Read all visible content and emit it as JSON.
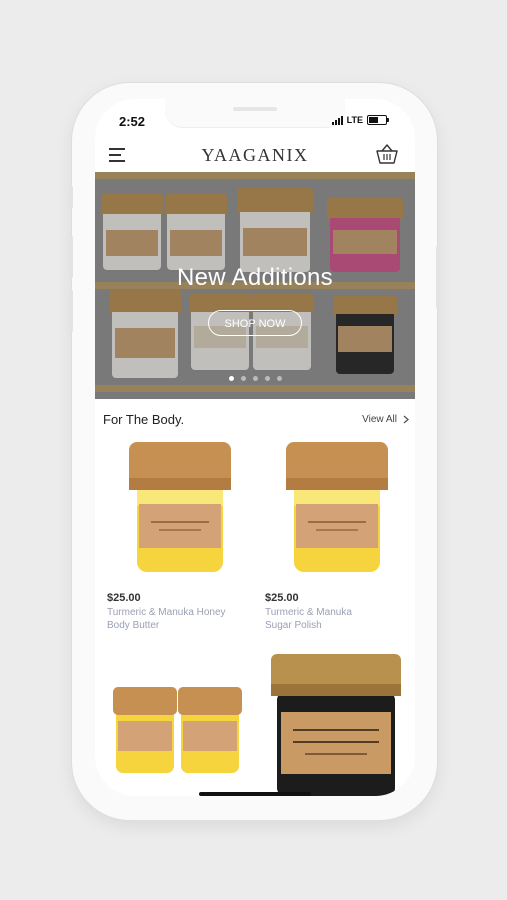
{
  "status_bar": {
    "time": "2:52",
    "network": "LTE"
  },
  "header": {
    "logo": "YAAGANIX",
    "menu_icon": "hamburger-menu-icon",
    "cart_icon": "basket-icon"
  },
  "banner": {
    "title": "New Additions",
    "button": "SHOP NOW",
    "slide_count": 5,
    "active_slide": 1
  },
  "section": {
    "title": "For The Body.",
    "view_all": "View All"
  },
  "products": [
    {
      "price": "$25.00",
      "name_line1": "Turmeric & Manuka Honey",
      "name_line2": "Body Butter"
    },
    {
      "price": "$25.00",
      "name_line1": "Turmeric & Manuka",
      "name_line2": "Sugar Polish"
    }
  ],
  "colors": {
    "lid": "#b88a4a",
    "yellow": "#f6d43e",
    "label": "#d3a377",
    "name_text": "#9b9fb3"
  }
}
